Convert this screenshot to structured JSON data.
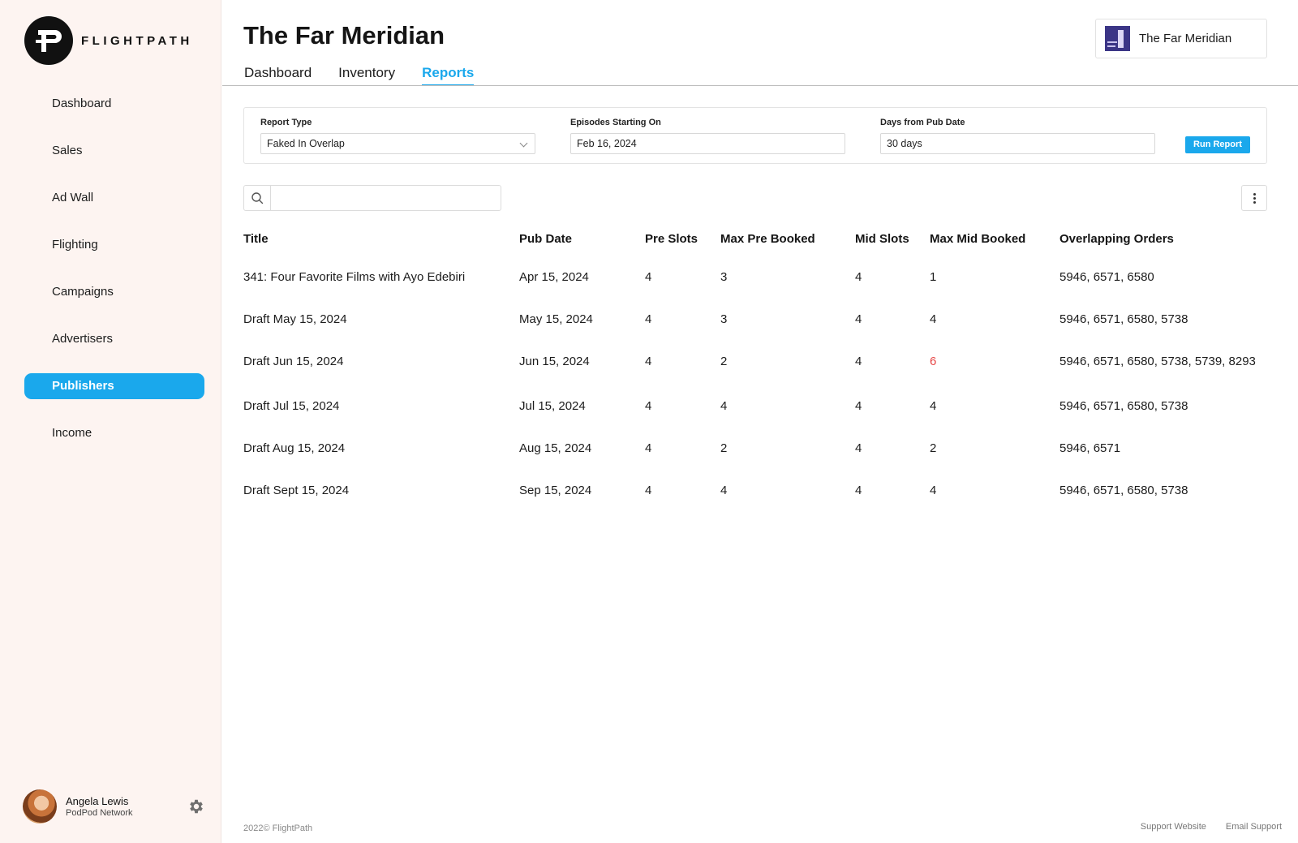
{
  "app": {
    "brand": "FLIGHTPATH"
  },
  "sidebar": {
    "items": [
      {
        "label": "Dashboard"
      },
      {
        "label": "Sales"
      },
      {
        "label": "Ad Wall"
      },
      {
        "label": "Flighting"
      },
      {
        "label": "Campaigns"
      },
      {
        "label": "Advertisers"
      },
      {
        "label": "Publishers",
        "active": true
      },
      {
        "label": "Income"
      }
    ],
    "user": {
      "name": "Angela Lewis",
      "org": "PodPod Network"
    }
  },
  "header": {
    "title": "The Far Meridian",
    "publisher_chip": "The Far Meridian",
    "tabs": [
      {
        "label": "Dashboard"
      },
      {
        "label": "Inventory"
      },
      {
        "label": "Reports",
        "active": true
      }
    ]
  },
  "filters": {
    "report_type": {
      "label": "Report Type",
      "value": "Faked In Overlap"
    },
    "episodes_start": {
      "label": "Episodes Starting On",
      "value": "Feb 16, 2024"
    },
    "days_from_pub": {
      "label": "Days from Pub Date",
      "value": "30 days"
    },
    "run_label": "Run Report"
  },
  "search": {
    "placeholder": ""
  },
  "table": {
    "columns": [
      "Title",
      "Pub Date",
      "Pre Slots",
      "Max Pre Booked",
      "Mid Slots",
      "Max Mid Booked",
      "Overlapping Orders"
    ],
    "rows": [
      [
        "341: Four Favorite Films with Ayo Edebiri",
        "Apr 15, 2024",
        "4",
        "3",
        "4",
        "1",
        "5946, 6571, 6580"
      ],
      [
        "Draft May 15, 2024",
        "May 15, 2024",
        "4",
        "3",
        "4",
        "4",
        "5946, 6571, 6580, 5738"
      ],
      [
        "Draft Jun 15, 2024",
        "Jun 15, 2024",
        "4",
        "2",
        "4",
        "6",
        "5946, 6571, 6580, 5738, 5739, 8293"
      ],
      [
        "Draft Jul 15, 2024",
        "Jul 15, 2024",
        "4",
        "4",
        "4",
        "4",
        "5946, 6571, 6580, 5738"
      ],
      [
        "Draft Aug 15, 2024",
        "Aug 15, 2024",
        "4",
        "2",
        "4",
        "2",
        "5946, 6571"
      ],
      [
        "Draft Sept 15, 2024",
        "Sep 15, 2024",
        "4",
        "4",
        "4",
        "4",
        "5946, 6571, 6580, 5738"
      ]
    ],
    "warning_color": "#e64747"
  },
  "footer": {
    "copyright": "2022© FlightPath",
    "links": [
      "Support Website",
      "Email Support"
    ]
  },
  "colors": {
    "accent": "#1aa8ec",
    "sidebar_bg": "#fdf4f1"
  }
}
